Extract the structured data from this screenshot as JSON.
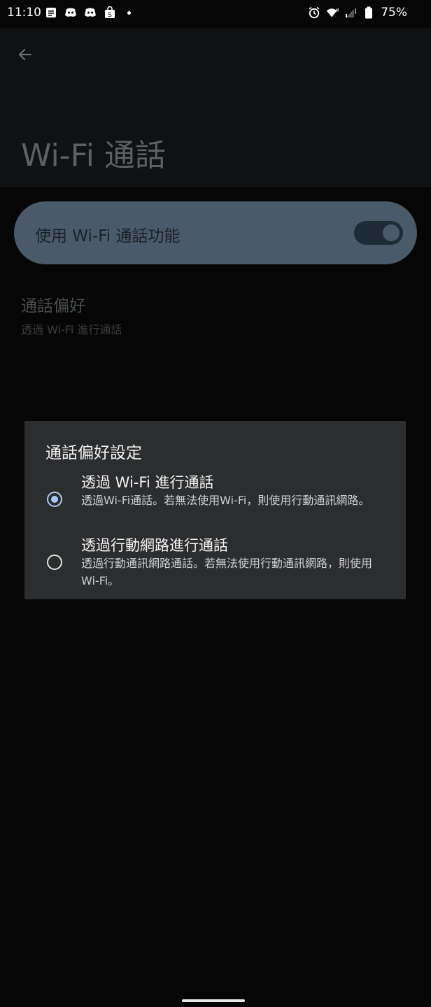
{
  "status_bar": {
    "time": "11:10",
    "battery": "75%",
    "icons_left": [
      "notes-icon",
      "discord-icon",
      "discord-icon",
      "shopping-bag-icon",
      "dot-icon"
    ],
    "icons_right": [
      "alarm-icon",
      "wifi-icon",
      "signal-icon",
      "battery-icon"
    ]
  },
  "header": {
    "title": "Wi-Fi 通話",
    "back_icon": "arrow-back-icon"
  },
  "main_switch": {
    "label": "使用 Wi-Fi 通話功能",
    "checked": true,
    "colors": {
      "card": "#4a5a69",
      "track": "#1f2b35"
    }
  },
  "preference": {
    "title": "通話偏好",
    "summary": "透過 Wi-Fi 進行通話"
  },
  "dialog": {
    "title": "通話偏好設定",
    "options": [
      {
        "title": "透過 Wi-Fi 進行通話",
        "summary": "透過Wi-Fi通話。若無法使用Wi-Fi，則使用行動通訊網路。",
        "selected": true
      },
      {
        "title": "透過行動網路進行通話",
        "summary": "透過行動通訊網路通話。若無法使用行動通訊網路，則使用Wi-Fi。",
        "selected": false
      }
    ],
    "accent": "#a8c8f0"
  }
}
